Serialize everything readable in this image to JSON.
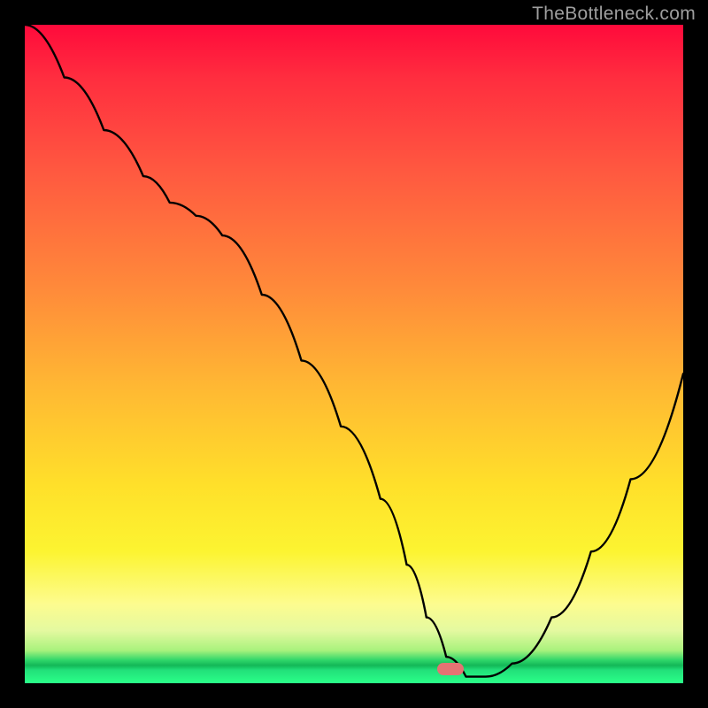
{
  "watermark": "TheBottleneck.com",
  "marker": {
    "x_frac": 0.647,
    "y_frac": 0.979
  },
  "chart_data": {
    "type": "line",
    "title": "",
    "xlabel": "",
    "ylabel": "",
    "xlim": [
      0,
      100
    ],
    "ylim": [
      0,
      100
    ],
    "series": [
      {
        "name": "bottleneck-curve",
        "x": [
          0,
          6,
          12,
          18,
          22,
          26,
          30,
          36,
          42,
          48,
          54,
          58,
          61,
          64,
          67,
          70,
          74,
          80,
          86,
          92,
          100
        ],
        "y": [
          100,
          92,
          84,
          77,
          73,
          71,
          68,
          59,
          49,
          39,
          28,
          18,
          10,
          4,
          1,
          1,
          3,
          10,
          20,
          31,
          47
        ]
      }
    ],
    "annotations": [
      {
        "name": "optimal-marker",
        "x": 64.7,
        "y": 2.1
      }
    ],
    "background_gradient": {
      "top": "#ff0a3b",
      "mid1": "#ff8a3a",
      "mid2": "#ffe02a",
      "bottom": "#2aff88"
    }
  }
}
